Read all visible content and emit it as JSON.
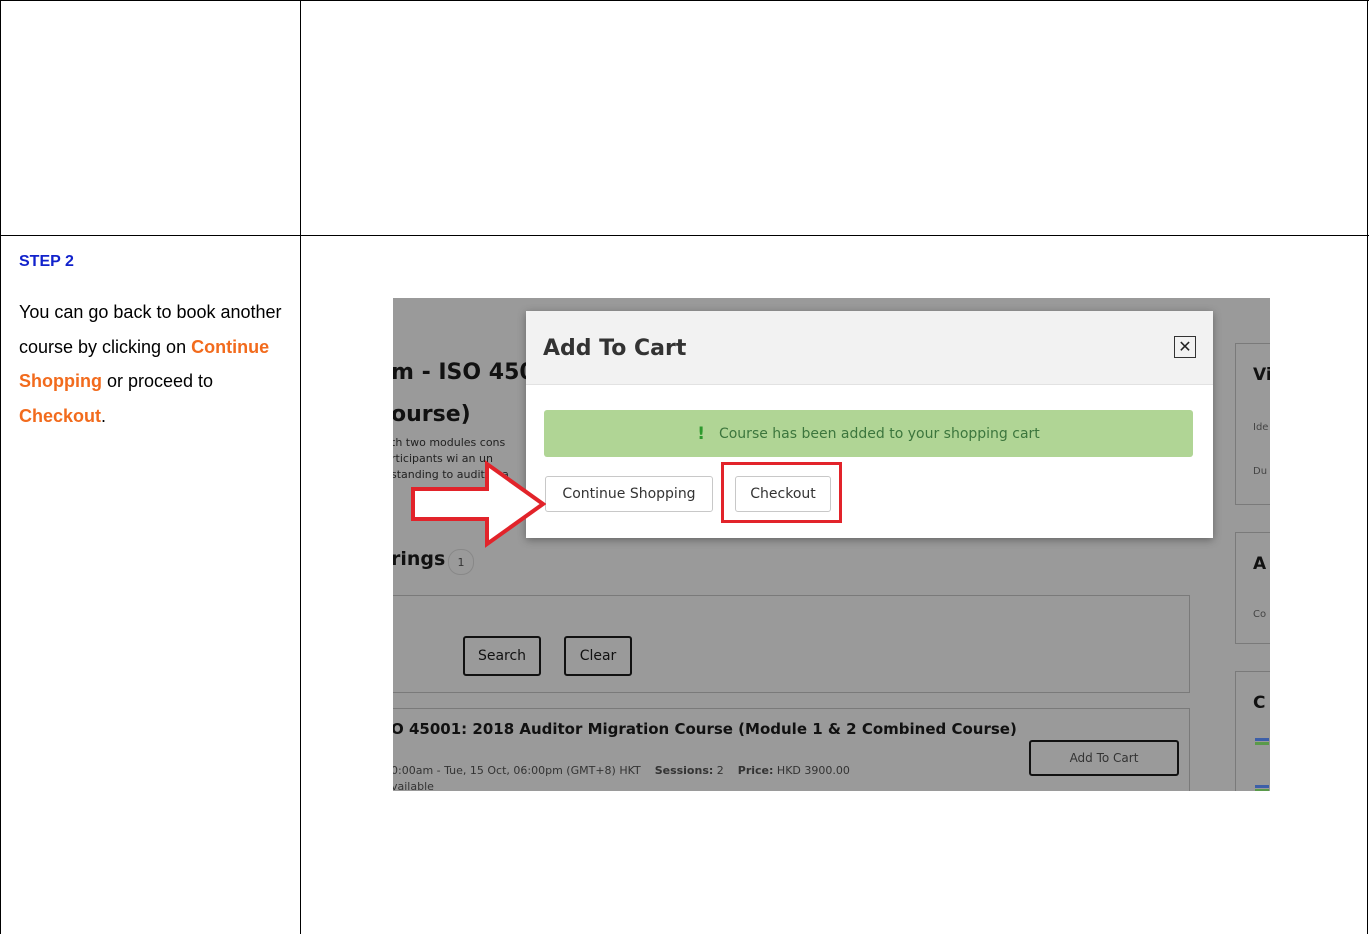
{
  "step": {
    "title": "STEP 2",
    "text_1": "You can go back to book another course by clicking on ",
    "continue_label": "Continue Shopping",
    "text_2": " or proceed to ",
    "checkout_label": "Checkout",
    "text_3": "."
  },
  "background_page": {
    "heading_line1": "m - ISO 450",
    "heading_line2": "ourse)",
    "desc_1": "th two modules cons",
    "desc_2": "rticipants wi   an un",
    "desc_3": "standing to audit aga",
    "offerings_label": "rings",
    "offerings_count": "1",
    "search_button": "Search",
    "clear_button": "Clear",
    "course_title": "O 45001: 2018 Auditor Migration Course (Module 1 & 2 Combined Course)",
    "schedule": "0:00am - Tue, 15 Oct, 06:00pm (GMT+8) HKT",
    "sessions_label": "Sessions:",
    "sessions_value": "2",
    "price_label": "Price:",
    "price_value": "HKD 3900.00",
    "availability": "vailable",
    "add_to_cart_button": "Add To Cart",
    "side_v": "Vi",
    "side_ide": "Ide",
    "side_du": "Du",
    "side_a": "A",
    "side_co": "Co",
    "side_c": "C"
  },
  "modal": {
    "title": "Add To Cart",
    "close_symbol": "✕",
    "alert_symbol": "!",
    "alert_message": "Course has been added to your shopping cart",
    "continue_button": "Continue Shopping",
    "checkout_button": "Checkout"
  },
  "colors": {
    "step_title": "#1122cc",
    "highlight_text": "#f26b1d",
    "alert_bg": "#b0d595",
    "annotation_red": "#e2232a"
  }
}
